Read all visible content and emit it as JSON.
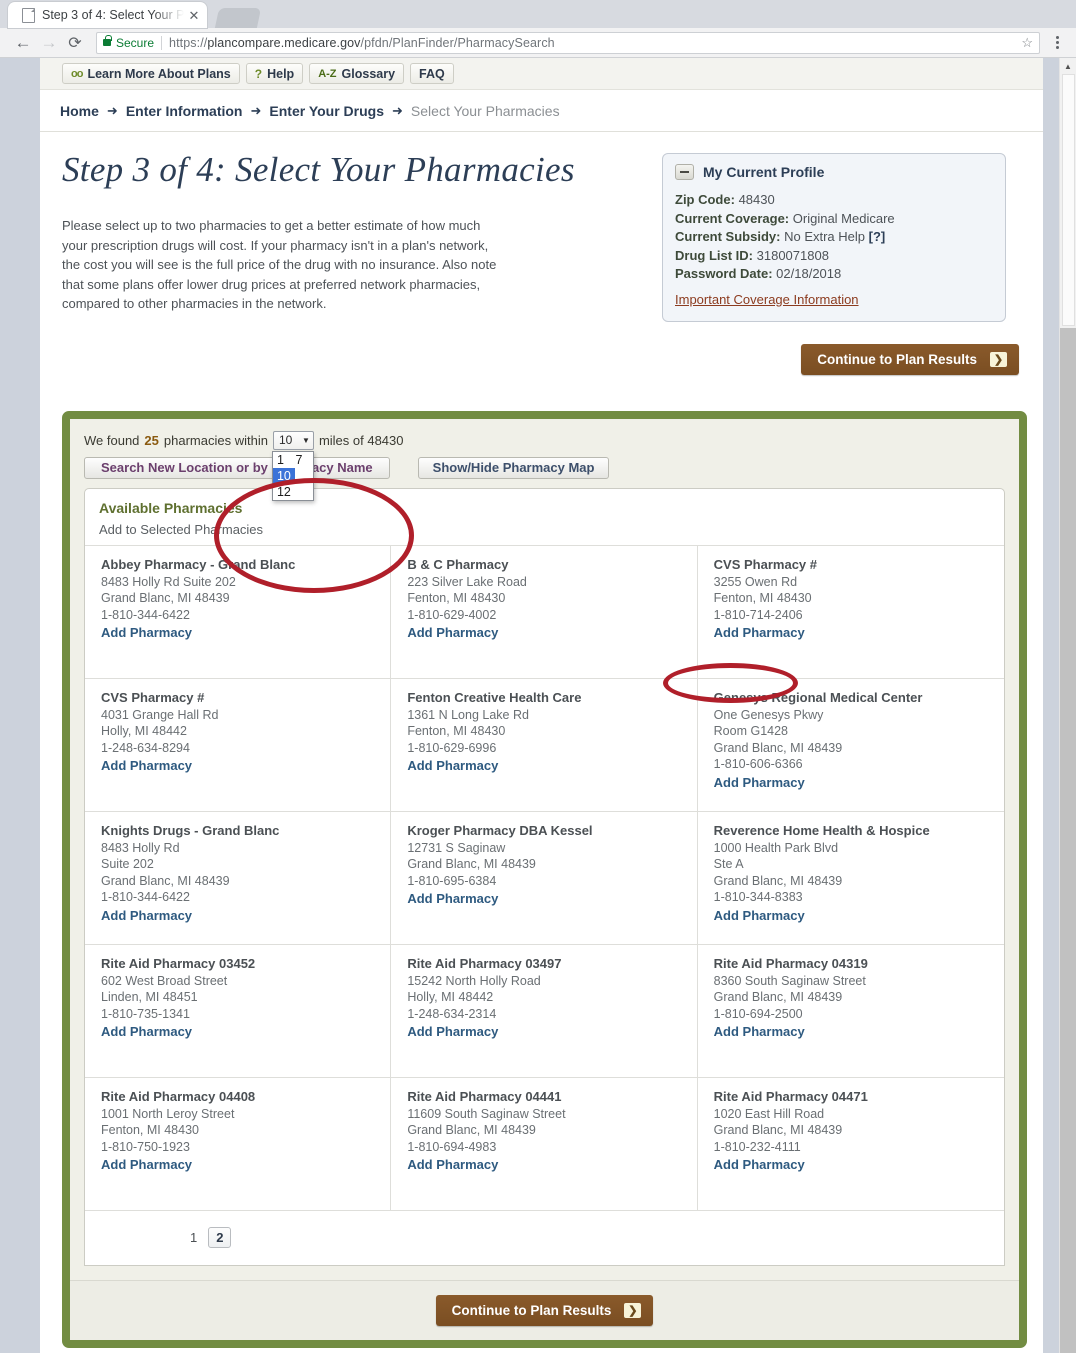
{
  "browser": {
    "tab_title": "Step 3 of 4: Select Your P",
    "tab_close": "✕",
    "back_icon": "←",
    "forward_icon": "→",
    "reload_icon": "⟳",
    "secure_label": "Secure",
    "url_scheme": "https://",
    "url_host": "plancompare.medicare.gov",
    "url_path": "/pfdn/PlanFinder/PharmacySearch",
    "star_icon": "☆"
  },
  "util_nav": [
    {
      "label": "Learn More About Plans",
      "icon": "glasses-icon",
      "glyph": "oo"
    },
    {
      "label": "Help",
      "icon": "question-icon",
      "glyph": "?"
    },
    {
      "label": "Glossary",
      "icon": "a-z-icon",
      "glyph": "A-Z"
    },
    {
      "label": "FAQ",
      "icon": "none",
      "glyph": ""
    }
  ],
  "breadcrumb": {
    "arrow": "➜",
    "items": [
      {
        "label": "Home",
        "current": false
      },
      {
        "label": "Enter Information",
        "current": false
      },
      {
        "label": "Enter Your Drugs",
        "current": false
      },
      {
        "label": "Select Your Pharmacies",
        "current": true
      }
    ]
  },
  "hero": {
    "title": "Step 3 of 4: Select Your Pharmacies",
    "intro": "Please select up to two pharmacies to get a better estimate of how much your prescription drugs will cost. If your pharmacy isn't in a plan's network, the cost you will see is the full price of the drug with no insurance. Also note that some plans offer lower drug prices at preferred network pharmacies, compared to other pharmacies in the network."
  },
  "profile": {
    "title": "My Current Profile",
    "collapse_glyph": "—",
    "rows": [
      {
        "label": "Zip Code:",
        "value": "48430"
      },
      {
        "label": "Current Coverage:",
        "value": "Original Medicare"
      },
      {
        "label": "Current Subsidy:",
        "value": "No Extra Help",
        "help": "[?]"
      },
      {
        "label": "Drug List ID:",
        "value": "3180071808"
      },
      {
        "label": "Password Date:",
        "value": "02/18/2018"
      }
    ],
    "link": "Important Coverage Information"
  },
  "continue_button": {
    "label": "Continue to Plan Results",
    "arrow": "❯"
  },
  "search_panel": {
    "found_prefix": "We found",
    "found_count": "25",
    "found_middle": "pharmacies within",
    "found_suffix": "miles of 48430",
    "radius_selected": "10",
    "radius_caret": "▼",
    "radius_options": [
      "1",
      "7",
      "10",
      "12"
    ],
    "search_button": "Search New Location or by Pharmacy Name",
    "map_button": "Show/Hide Pharmacy Map"
  },
  "available": {
    "heading": "Available Pharmacies",
    "subheading": "Add to Selected Pharmacies",
    "add_link_label": "Add Pharmacy",
    "pharmacies": [
      {
        "name": "Abbey Pharmacy - Grand Blanc",
        "lines": [
          "8483 Holly Rd Suite 202",
          "Grand Blanc, MI 48439",
          "1-810-344-6422"
        ]
      },
      {
        "name": "B & C Pharmacy",
        "lines": [
          "223 Silver Lake Road",
          "Fenton, MI 48430",
          "1-810-629-4002"
        ]
      },
      {
        "name": "CVS Pharmacy #",
        "lines": [
          "3255 Owen Rd",
          "Fenton, MI 48430",
          "1-810-714-2406"
        ]
      },
      {
        "name": "CVS Pharmacy #",
        "lines": [
          "4031 Grange Hall Rd",
          "Holly, MI 48442",
          "1-248-634-8294"
        ]
      },
      {
        "name": "Fenton Creative Health Care",
        "lines": [
          "1361 N Long Lake Rd",
          "Fenton, MI 48430",
          "1-810-629-6996"
        ]
      },
      {
        "name": "Genesys Regional Medical Center",
        "lines": [
          "One Genesys Pkwy",
          "Room G1428",
          "Grand Blanc, MI 48439",
          "1-810-606-6366"
        ]
      },
      {
        "name": "Knights Drugs - Grand Blanc",
        "lines": [
          "8483 Holly Rd",
          "Suite 202",
          "Grand Blanc, MI 48439",
          "1-810-344-6422"
        ]
      },
      {
        "name": "Kroger Pharmacy DBA Kessel",
        "lines": [
          "12731 S Saginaw",
          "Grand Blanc, MI 48439",
          "1-810-695-6384"
        ]
      },
      {
        "name": "Reverence Home Health & Hospice",
        "lines": [
          "1000 Health Park Blvd",
          "Ste A",
          "Grand Blanc, MI 48439",
          "1-810-344-8383"
        ]
      },
      {
        "name": "Rite Aid Pharmacy 03452",
        "lines": [
          "602 West Broad Street",
          "Linden, MI 48451",
          "1-810-735-1341"
        ]
      },
      {
        "name": "Rite Aid Pharmacy 03497",
        "lines": [
          "15242 North Holly Road",
          "Holly, MI 48442",
          "1-248-634-2314"
        ]
      },
      {
        "name": "Rite Aid Pharmacy 04319",
        "lines": [
          "8360 South Saginaw Street",
          "Grand Blanc, MI 48439",
          "1-810-694-2500"
        ]
      },
      {
        "name": "Rite Aid Pharmacy 04408",
        "lines": [
          "1001 North Leroy Street",
          "Fenton, MI 48430",
          "1-810-750-1923"
        ]
      },
      {
        "name": "Rite Aid Pharmacy 04441",
        "lines": [
          "11609 South Saginaw Street",
          "Grand Blanc, MI 48439",
          "1-810-694-4983"
        ]
      },
      {
        "name": "Rite Aid Pharmacy 04471",
        "lines": [
          "1020 East Hill Road",
          "Grand Blanc, MI 48439",
          "1-810-232-4111"
        ]
      }
    ],
    "pagination": [
      {
        "label": "1",
        "active": true
      },
      {
        "label": "2",
        "active": false
      }
    ]
  },
  "colors": {
    "green_border": "#728c42",
    "brown_button": "#7a4e22",
    "annotation_red": "#b01f2a",
    "link_blue": "#2e5a80",
    "heading_navy": "#2c3e56",
    "select_highlight": "#3b73d8"
  }
}
